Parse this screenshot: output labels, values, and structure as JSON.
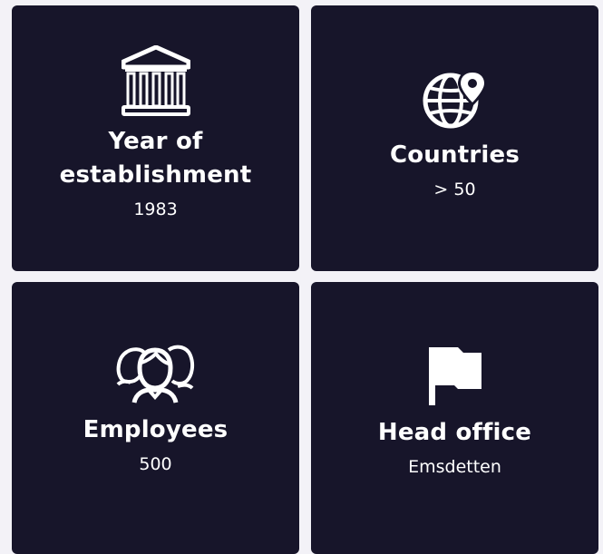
{
  "cards": [
    {
      "icon": "museum-building-icon",
      "title": "Year of\nestablishment",
      "value": "1983"
    },
    {
      "icon": "globe-location-icon",
      "title": "Countries",
      "value": "> 50"
    },
    {
      "icon": "people-group-icon",
      "title": "Employees",
      "value": "500"
    },
    {
      "icon": "flag-icon",
      "title": "Head office",
      "value": "Emsdetten"
    }
  ],
  "colors": {
    "card_background": "#17152a",
    "page_background": "#f3f2f7",
    "text": "#ffffff"
  }
}
